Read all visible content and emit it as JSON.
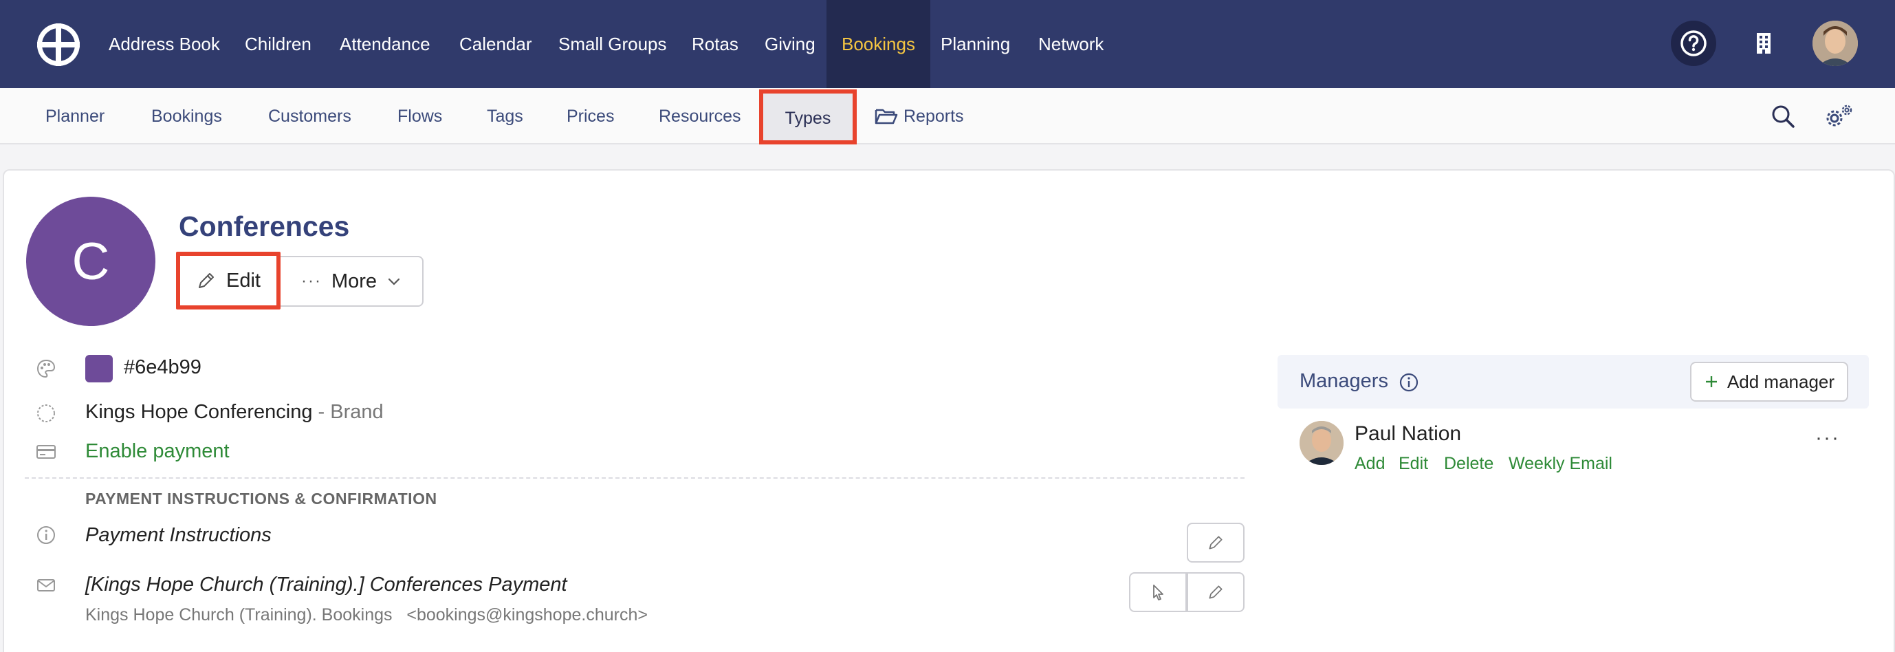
{
  "topnav": {
    "items": [
      "Address Book",
      "Children",
      "Attendance",
      "Calendar",
      "Small Groups",
      "Rotas",
      "Giving",
      "Bookings",
      "Planning",
      "Network"
    ],
    "active": "Bookings"
  },
  "subnav": {
    "items": [
      "Planner",
      "Bookings",
      "Customers",
      "Flows",
      "Tags",
      "Prices",
      "Resources",
      "Types",
      "Reports"
    ],
    "active": "Types"
  },
  "type": {
    "initial": "C",
    "title": "Conferences",
    "color_hex": "#6e4b99",
    "brand_name": "Kings Hope Conferencing",
    "brand_suffix": "- Brand",
    "payment_link": "Enable payment"
  },
  "buttons": {
    "edit": "Edit",
    "more": "More"
  },
  "payment": {
    "section_heading": "PAYMENT INSTRUCTIONS & CONFIRMATION",
    "instructions_title": "Payment Instructions",
    "email_subject": "[Kings Hope Church (Training).] Conferences Payment",
    "email_from_name": "Kings Hope Church (Training). Bookings",
    "email_from_address": "<bookings@kingshope.church>"
  },
  "managers": {
    "title": "Managers",
    "add_button": "Add manager",
    "people": [
      {
        "name": "Paul Nation",
        "actions": [
          "Add",
          "Edit",
          "Delete",
          "Weekly Email"
        ]
      }
    ]
  },
  "colors": {
    "nav_bg": "#303a6b",
    "nav_active_text": "#f4c542",
    "accent_purple": "#6e4b99",
    "link_green": "#2e8a37",
    "highlight_red": "#e8432d"
  }
}
